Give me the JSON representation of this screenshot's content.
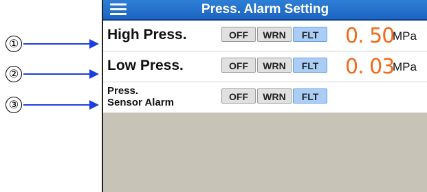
{
  "callouts": [
    "①",
    "②",
    "③"
  ],
  "header": {
    "title": "Press. Alarm Setting",
    "menu_icon": "hamburger-menu-icon"
  },
  "colors": {
    "header": "#1d64c2",
    "value": "#f06a18",
    "selected_button": "#aacdf6"
  },
  "rows": [
    {
      "label": "High Press.",
      "options": [
        "OFF",
        "WRN",
        "FLT"
      ],
      "selected": "FLT",
      "value": "0. 50",
      "unit": "MPa"
    },
    {
      "label": "Low Press.",
      "options": [
        "OFF",
        "WRN",
        "FLT"
      ],
      "selected": "FLT",
      "value": "0. 03",
      "unit": "MPa"
    },
    {
      "label_line1": "Press.",
      "label_line2": "Sensor Alarm",
      "options": [
        "OFF",
        "WRN",
        "FLT"
      ],
      "selected": "FLT"
    }
  ]
}
